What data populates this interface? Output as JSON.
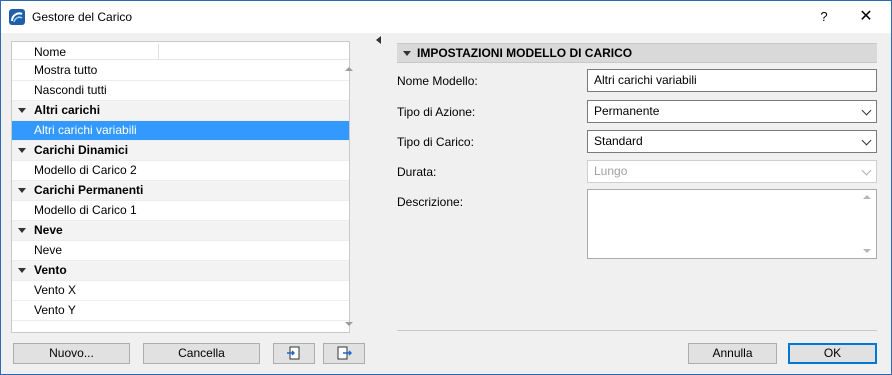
{
  "window": {
    "title": "Gestore del Carico",
    "help_label": "?",
    "close_label": "✕"
  },
  "tree": {
    "column_header": "Nome",
    "rows": [
      {
        "type": "leaf",
        "label": "Mostra tutto"
      },
      {
        "type": "leaf",
        "label": "Nascondi tutti"
      },
      {
        "type": "group",
        "label": "Altri carichi"
      },
      {
        "type": "leaf",
        "label": "Altri carichi variabili",
        "selected": true
      },
      {
        "type": "group",
        "label": "Carichi Dinamici"
      },
      {
        "type": "leaf",
        "label": "Modello di Carico 2"
      },
      {
        "type": "group",
        "label": "Carichi Permanenti"
      },
      {
        "type": "leaf",
        "label": "Modello di Carico 1"
      },
      {
        "type": "group",
        "label": "Neve"
      },
      {
        "type": "leaf",
        "label": "Neve"
      },
      {
        "type": "group",
        "label": "Vento"
      },
      {
        "type": "leaf",
        "label": "Vento X"
      },
      {
        "type": "leaf",
        "label": "Vento Y"
      }
    ]
  },
  "left_buttons": {
    "new_label": "Nuovo...",
    "delete_label": "Cancella"
  },
  "panel": {
    "section_title": "IMPOSTAZIONI MODELLO DI CARICO",
    "model_name": {
      "label": "Nome Modello:",
      "value": "Altri carichi variabili"
    },
    "action_type": {
      "label": "Tipo di Azione:",
      "value": "Permanente"
    },
    "load_type": {
      "label": "Tipo di Carico:",
      "value": "Standard"
    },
    "duration": {
      "label": "Durata:",
      "value": "Lungo"
    },
    "description": {
      "label": "Descrizione:",
      "value": ""
    }
  },
  "footer": {
    "cancel_label": "Annulla",
    "ok_label": "OK"
  },
  "colors": {
    "selection": "#3399ff",
    "accent": "#0078d7"
  }
}
